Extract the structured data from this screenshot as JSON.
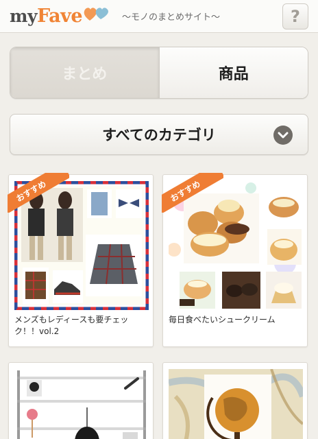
{
  "header": {
    "logo_my": "my",
    "logo_fave": "Fave",
    "tagline": "〜モノのまとめサイト〜",
    "help_label": "?"
  },
  "tabs": [
    {
      "label": "まとめ",
      "active": true
    },
    {
      "label": "商品",
      "active": false
    }
  ],
  "category": {
    "label": "すべてのカテゴリ",
    "icon": "chevron-down-icon"
  },
  "cards": [
    {
      "badge": "おすすめ",
      "title": "メンズもレディースも要チェック！！vol.2"
    },
    {
      "badge": "おすすめ",
      "title": "毎日食べたいシュークリーム"
    },
    {
      "title": ""
    },
    {
      "title": ""
    }
  ],
  "colors": {
    "accent": "#f08435",
    "background": "#f1efea",
    "badge": "#ef7d34"
  }
}
